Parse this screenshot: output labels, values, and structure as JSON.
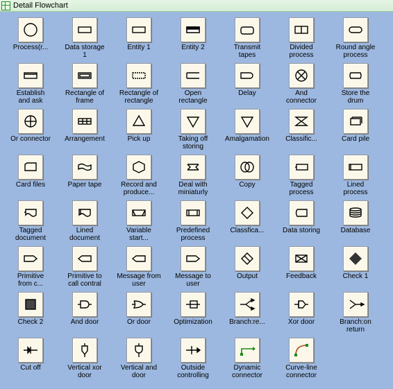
{
  "window": {
    "title": "Detail Flowchart"
  },
  "shapes": [
    {
      "id": "process-r",
      "label": "Process(r..."
    },
    {
      "id": "data-storage-1",
      "label": "Data storage\n1"
    },
    {
      "id": "entity-1",
      "label": "Entity 1"
    },
    {
      "id": "entity-2",
      "label": "Entity 2"
    },
    {
      "id": "transmit-tapes",
      "label": "Transmit\ntapes"
    },
    {
      "id": "divided-process",
      "label": "Divided\nprocess"
    },
    {
      "id": "round-angle-process",
      "label": "Round angle\nprocess"
    },
    {
      "id": "establish-and-ask",
      "label": "Establish\nand ask"
    },
    {
      "id": "rectangle-of-frame",
      "label": "Rectangle of\nframe"
    },
    {
      "id": "rectangle-of-rectangle",
      "label": "Rectangle of\nrectangle"
    },
    {
      "id": "open-rectangle",
      "label": "Open\nrectangle"
    },
    {
      "id": "delay",
      "label": "Delay"
    },
    {
      "id": "and-connector",
      "label": "And\nconnector"
    },
    {
      "id": "store-the-drum",
      "label": "Store the\ndrum"
    },
    {
      "id": "or-connector",
      "label": "Or connector"
    },
    {
      "id": "arrangement",
      "label": "Arrangement"
    },
    {
      "id": "pick-up",
      "label": "Pick up"
    },
    {
      "id": "taking-off-storing",
      "label": "Taking off\nstoring"
    },
    {
      "id": "amalgamation",
      "label": "Amalgamation"
    },
    {
      "id": "classification",
      "label": "Classific..."
    },
    {
      "id": "card-pile",
      "label": "Card pile"
    },
    {
      "id": "card-files",
      "label": "Card files"
    },
    {
      "id": "paper-tape",
      "label": "Paper tape"
    },
    {
      "id": "record-and-produce",
      "label": "Record and\nproduce..."
    },
    {
      "id": "deal-with-miniatury",
      "label": "Deal with\nminiaturly"
    },
    {
      "id": "copy",
      "label": "Copy"
    },
    {
      "id": "tagged-process",
      "label": "Tagged\nprocess"
    },
    {
      "id": "lined-process",
      "label": "Lined\nprocess"
    },
    {
      "id": "tagged-document",
      "label": "Tagged\ndocument"
    },
    {
      "id": "lined-document",
      "label": "Lined\ndocument"
    },
    {
      "id": "variable-start",
      "label": "Variable\nstart..."
    },
    {
      "id": "predefined-process",
      "label": "Predefined\nprocess"
    },
    {
      "id": "classifica",
      "label": "Classfica..."
    },
    {
      "id": "data-storing",
      "label": "Data storing"
    },
    {
      "id": "database",
      "label": "Database"
    },
    {
      "id": "primitive-from-c",
      "label": "Primitive\nfrom c..."
    },
    {
      "id": "primitive-to-call",
      "label": "Primitive to\ncall contral"
    },
    {
      "id": "message-from-user",
      "label": "Message from\nuser"
    },
    {
      "id": "message-to-user",
      "label": "Message to\nuser"
    },
    {
      "id": "output",
      "label": "Output"
    },
    {
      "id": "feedback",
      "label": "Feedback"
    },
    {
      "id": "check-1",
      "label": "Check 1"
    },
    {
      "id": "check-2",
      "label": "Check 2"
    },
    {
      "id": "and-door",
      "label": "And door"
    },
    {
      "id": "or-door",
      "label": "Or door"
    },
    {
      "id": "optimization",
      "label": "Optimization"
    },
    {
      "id": "branch-re",
      "label": "Branch:re..."
    },
    {
      "id": "xor-door",
      "label": "Xor door"
    },
    {
      "id": "branch-on-return",
      "label": "Branch:on\nreturn"
    },
    {
      "id": "cut-off",
      "label": "Cut off"
    },
    {
      "id": "vertical-xor-door",
      "label": "Vertical xor\ndoor"
    },
    {
      "id": "vertical-and-door",
      "label": "Vertical and\ndoor"
    },
    {
      "id": "outside-controlling",
      "label": "Outside\ncontrolling"
    },
    {
      "id": "dynamic-connector",
      "label": "Dynamic\nconnector"
    },
    {
      "id": "curve-line-connector",
      "label": "Curve-line\nconnector"
    }
  ]
}
